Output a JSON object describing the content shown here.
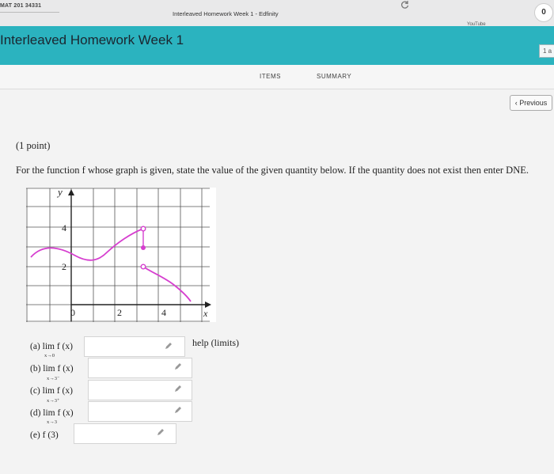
{
  "browser": {
    "left_tab": "MAT 201 34331",
    "title": "Interleaved Homework Week 1 - Edfinity",
    "youtube_tab": "YouTube",
    "badge": "0"
  },
  "header": {
    "title": "Interleaved Homework Week 1",
    "side_button": "1 a"
  },
  "nav": {
    "items": "ITEMS",
    "summary": "SUMMARY"
  },
  "previous_button": "Previous",
  "problem": {
    "points": "(1 point)",
    "prompt": "For the function f whose graph is given, state the value of the given quantity below. If the quantity does not exist then enter DNE."
  },
  "graph": {
    "y_axis_label": "y",
    "x_axis_label": "x",
    "y_ticks": [
      "4",
      "2",
      "0"
    ],
    "x_ticks": [
      "2",
      "4"
    ],
    "curve_color": "#d63fcf"
  },
  "questions": [
    {
      "label": "(a) lim f (x)",
      "sub": "x→0",
      "value": ""
    },
    {
      "label": "(b) lim f (x)",
      "sub": "x→3⁻",
      "value": ""
    },
    {
      "label": "(c) lim f (x)",
      "sub": "x→3⁺",
      "value": ""
    },
    {
      "label": "(d) lim f (x)",
      "sub": "x→3",
      "value": ""
    },
    {
      "label": "(e) f (3)",
      "sub": "",
      "value": ""
    }
  ],
  "help_link": "help (limits)"
}
